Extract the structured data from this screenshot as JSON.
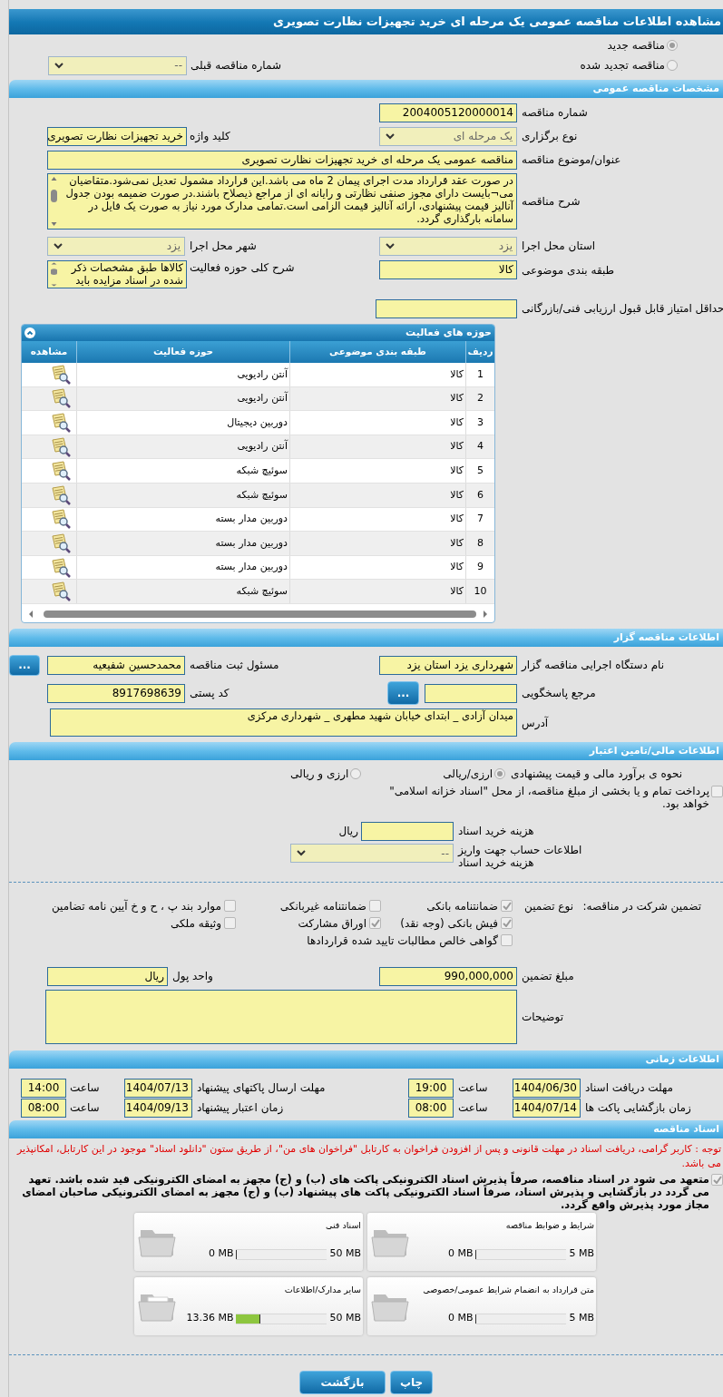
{
  "title": "مشاهده اطلاعات مناقصه عمومی یک مرحله ای خرید تجهیزات نظارت تصویری",
  "tender_status": [
    {
      "label": "مناقصه جدید",
      "selected": true
    },
    {
      "label": "مناقصه تجدید شده",
      "selected": false
    }
  ],
  "previous_tender": {
    "label": "شماره مناقصه قبلی",
    "value": "--"
  },
  "general": {
    "header": "مشخصات مناقصه عمومی",
    "tender_number": {
      "label": "شماره مناقصه",
      "value": "2004005120000014"
    },
    "holding_type": {
      "label": "نوع برگزاری",
      "value": "یک مرحله ای"
    },
    "keyword": {
      "label": "کلید واژه",
      "value": "خرید تجهیزات نظارت تصویری"
    },
    "subject": {
      "label": "عنوان/موضوع مناقصه",
      "value": "مناقصه عمومی یک مرحله ای خرید تجهیزات نظارت تصویری"
    },
    "description": {
      "label": "شرح مناقصه",
      "value": "در صورت عقد قرارداد مدت اجرای پیمان 2 ماه می باشد.این قرارداد مشمول تعدیل نمی‌شود.متقاضیان می¬بایست دارای مجوز صنفی نظارتی و رایانه ای از مراجع ذیصلاح باشند.در صورت ضمیمه بودن جدول آنالیز قیمت پیشنهادی، ارائه آنالیز قیمت الزامی است.تمامی مدارک مورد نیاز به صورت یک فایل در سامانه بارگذاری گردد."
    },
    "province": {
      "label": "استان محل اجرا",
      "value": "یزد"
    },
    "city": {
      "label": "شهر محل اجرا",
      "value": "یزد"
    },
    "category": {
      "label": "طبقه بندی موضوعی",
      "value": "کالا"
    },
    "activity_summary": {
      "label": "شرح کلی حوزه فعالیت",
      "value": "کالاها طبق مشخصات ذکر شده در اسناد مزایده باید"
    },
    "min_score": {
      "label": "حداقل امتیاز قابل قبول ارزیابی فنی/بازرگانی"
    }
  },
  "activities": {
    "title": "حوزه های فعالیت",
    "columns": [
      "ردیف",
      "طبقه بندی موضوعی",
      "حوزه فعالیت",
      "مشاهده"
    ],
    "rows": [
      {
        "number": "1",
        "category": "کالا",
        "field": "آنتن رادیویی"
      },
      {
        "number": "2",
        "category": "کالا",
        "field": "آنتن رادیویی"
      },
      {
        "number": "3",
        "category": "کالا",
        "field": "دوربین دیجیتال"
      },
      {
        "number": "4",
        "category": "کالا",
        "field": "آنتن رادیویی"
      },
      {
        "number": "5",
        "category": "کالا",
        "field": "سوئیچ شبکه"
      },
      {
        "number": "6",
        "category": "کالا",
        "field": "سوئیچ شبکه"
      },
      {
        "number": "7",
        "category": "کالا",
        "field": "دوربین مدار بسته"
      },
      {
        "number": "8",
        "category": "کالا",
        "field": "دوربین مدار بسته"
      },
      {
        "number": "9",
        "category": "کالا",
        "field": "دوربین مدار بسته"
      },
      {
        "number": "10",
        "category": "کالا",
        "field": "سوئیچ شبکه"
      }
    ]
  },
  "organizer": {
    "header": "اطلاعات مناقصه گزار",
    "org_name": {
      "label": "نام دستگاه اجرایی مناقصه گزار",
      "value": "شهرداری یزد استان یزد"
    },
    "registrar": {
      "label": "مسئول ثبت مناقصه",
      "value": "محمدحسین شفیعیه",
      "button": "..."
    },
    "responder": {
      "label": "مرجع پاسخگویی",
      "button": "..."
    },
    "postal_code": {
      "label": "کد پستی",
      "value": "8917698639"
    },
    "address": {
      "label": "آدرس",
      "value": "میدان آزادی _ ابتدای خیابان شهید مطهری _ شهرداری مرکزی"
    }
  },
  "finance": {
    "header": "اطلاعات مالی/تامین اعتبار",
    "estimate": {
      "label": "نحوه ی برآورد مالی و قیمت پیشنهادی",
      "options": [
        {
          "label": "ارزی/ریالی",
          "selected": true
        },
        {
          "label": "ارزی و ریالی",
          "selected": false
        }
      ]
    },
    "treasury": {
      "label": "پرداخت تمام و یا بخشی از مبلغ مناقصه، از محل \"اسناد خزانه اسلامی\" خواهد بود.",
      "checked": false
    },
    "doc_fee": {
      "label": "هزینه خرید اسناد",
      "unit": "ریال"
    },
    "account": {
      "label": "اطلاعات حساب جهت واریز هزینه خرید اسناد",
      "value": "--"
    }
  },
  "guarantee": {
    "label": "تضمین شرکت در مناقصه:",
    "type_label": "نوع تضمین",
    "options": [
      {
        "label": "ضمانتنامه بانکی",
        "checked": true
      },
      {
        "label": "ضمانتنامه غیربانکی",
        "checked": false
      },
      {
        "label": "موارد بند پ ، ح و خ آیین نامه تضامین",
        "checked": false
      },
      {
        "label": "فیش بانکی (وجه نقد)",
        "checked": true
      },
      {
        "label": "اوراق مشارکت",
        "checked": true
      },
      {
        "label": "وثیقه ملکی",
        "checked": false
      },
      {
        "label": "گواهی خالص مطالبات تایید شده قراردادها",
        "checked": false
      }
    ],
    "amount": {
      "label": "مبلغ تضمین",
      "value": "990,000,000"
    },
    "currency": {
      "label": "واحد پول",
      "value": "ریال"
    },
    "notes": {
      "label": "توضیحات"
    }
  },
  "timing": {
    "header": "اطلاعات زمانی",
    "rows": [
      {
        "label": "مهلت دریافت اسناد",
        "date": "1404/06/30",
        "time_label": "ساعت",
        "time": "19:00"
      },
      {
        "label": "مهلت ارسال پاکتهای پیشنهاد",
        "date": "1404/07/13",
        "time_label": "ساعت",
        "time": "14:00"
      },
      {
        "label": "زمان بازگشایی پاکت ها",
        "date": "1404/07/14",
        "time_label": "ساعت",
        "time": "08:00"
      },
      {
        "label": "زمان اعتبار پیشنهاد",
        "date": "1404/09/13",
        "time_label": "ساعت",
        "time": "08:00"
      }
    ]
  },
  "documents": {
    "header": "اسناد مناقصه",
    "notice": "توجه : کاربر گرامی، دریافت اسناد در مهلت قانونی و پس از افزودن فراخوان به کارتابل \"فراخوان های من\"، از طریق ستون \"دانلود اسناد\" موجود در این کارتابل، امکانپذیر می باشد.",
    "commitment": {
      "label": "متعهد می شود در اسناد مناقصه، صرفاً پذیرش اسناد الکترونیکی پاکت های (ب) و (ج) مجهز به امضای الکترونیکی قید شده باشد. تعهد می گردد در بازگشایی و پذیرش اسناد، صرفاً اسناد الکترونیکی پاکت های پیشنهاد (ب) و (ج) مجهز به امضای الکترونیکی صاحبان امضای مجاز مورد پذیرش واقع گردد.",
      "checked": true
    },
    "files": [
      {
        "name": "شرایط و ضوابط مناقصه",
        "used": "0 MB",
        "capacity": "5 MB",
        "level": 0
      },
      {
        "name": "اسناد فنی",
        "used": "0 MB",
        "capacity": "50 MB",
        "level": 0
      },
      {
        "name": "متن قرارداد به انضمام شرایط عمومی/خصوصی",
        "used": "0 MB",
        "capacity": "5 MB",
        "level": 0
      },
      {
        "name": "سایر مدارک/اطلاعات",
        "used": "13.36 MB",
        "capacity": "50 MB",
        "level": 0.27
      }
    ]
  },
  "buttons": [
    {
      "label": "چاپ"
    },
    {
      "label": "بازگشت"
    }
  ]
}
